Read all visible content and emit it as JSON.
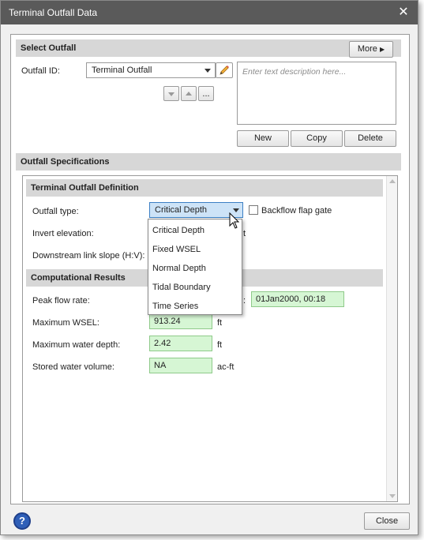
{
  "window": {
    "title": "Terminal Outfall Data"
  },
  "select_outfall": {
    "header": "Select Outfall",
    "more_label": "More",
    "outfall_id_label": "Outfall ID:",
    "outfall_id_value": "Terminal Outfall",
    "nav_more_label": "...",
    "description_placeholder": "Enter text description here...",
    "new_label": "New",
    "copy_label": "Copy",
    "delete_label": "Delete"
  },
  "specs": {
    "header": "Outfall Specifications",
    "definition_header": "Terminal Outfall Definition",
    "outfall_type_label": "Outfall type:",
    "outfall_type_value": "Critical Depth",
    "backflow_label": "Backflow flap gate",
    "backflow_checked": false,
    "invert_label": "Invert elevation:",
    "downstream_label": "Downstream link slope (H:V):",
    "dropdown_options": [
      "Critical Depth",
      "Fixed WSEL",
      "Normal Depth",
      "Tidal Boundary",
      "Time Series"
    ]
  },
  "results": {
    "header": "Computational Results",
    "peak_label": "Peak flow rate:",
    "peak_time": "01Jan2000, 00:18",
    "max_wsel_label": "Maximum WSEL:",
    "max_wsel_value": "913.24",
    "max_wsel_unit": "ft",
    "max_depth_label": "Maximum water depth:",
    "max_depth_value": "2.42",
    "max_depth_unit": "ft",
    "stored_label": "Stored water volume:",
    "stored_value": "NA",
    "stored_unit": "ac-ft"
  },
  "footer": {
    "help_label": "?",
    "close_label": "Close"
  },
  "colors": {
    "titlebar": "#5a5a5a",
    "section_header": "#d7d7d7",
    "result_field": "#d6f6d4",
    "combo_focus": "#cde3f7"
  }
}
